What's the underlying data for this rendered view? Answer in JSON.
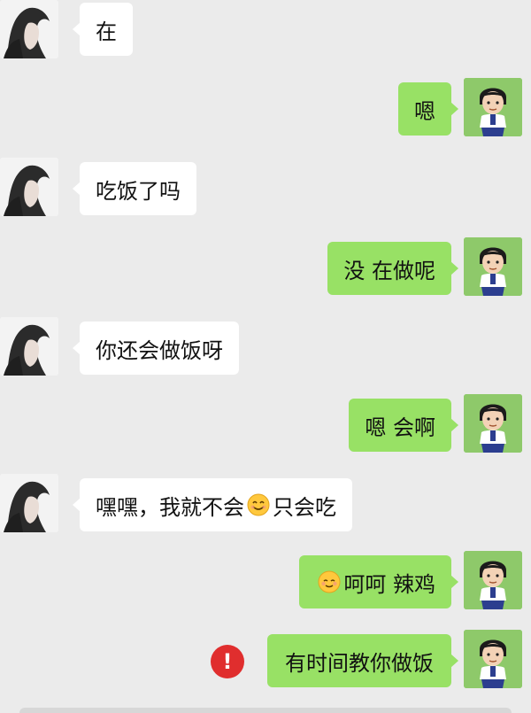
{
  "chat": {
    "messages": [
      {
        "side": "left",
        "text": "在"
      },
      {
        "side": "right",
        "text": "嗯"
      },
      {
        "side": "left",
        "text": "吃饭了吗"
      },
      {
        "side": "right",
        "text": "没 在做呢"
      },
      {
        "side": "left",
        "text": "你还会做饭呀"
      },
      {
        "side": "right",
        "text": "嗯 会啊"
      },
      {
        "side": "left",
        "text_before": "嘿嘿，我就不会",
        "emoji": "smile-emoji",
        "text_after": " 只会吃"
      },
      {
        "side": "right",
        "emoji": "shy-smile-emoji",
        "text_after": "呵呵 辣鸡"
      },
      {
        "side": "right",
        "text": "有时间教你做饭",
        "status": "send-failed",
        "status_icon_text": "!"
      }
    ]
  },
  "colors": {
    "background": "#ebebeb",
    "sent_bubble": "#98e165",
    "received_bubble": "#ffffff",
    "failed_icon": "#e02e2e"
  }
}
